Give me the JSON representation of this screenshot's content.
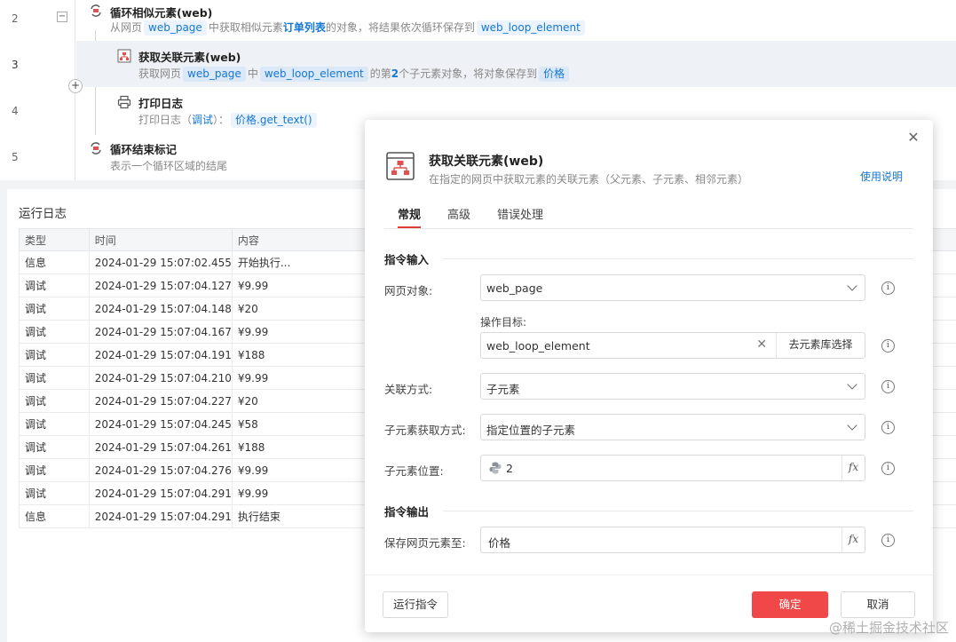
{
  "flow": {
    "steps": [
      {
        "num": "2",
        "title": "循环相似元素(web)",
        "desc_parts": [
          "从网页",
          "web_page",
          "中获取相似元素",
          "订单列表",
          "的对象，将结果依次循环保存到",
          "web_loop_element"
        ]
      },
      {
        "num": "3",
        "title": "获取关联元素(web)",
        "desc_parts": [
          "获取网页",
          "web_page",
          "中",
          "web_loop_element",
          "的第",
          "2",
          "个子元素对象，将对象保存到",
          "价格"
        ]
      },
      {
        "num": "4",
        "title": "打印日志",
        "desc_parts": [
          "打印日志（",
          "调试",
          "）：",
          "价格.get_text()"
        ]
      },
      {
        "num": "5",
        "title": "循环结束标记",
        "desc": "表示一个循环区域的结尾"
      }
    ],
    "collapse_symbol": "−",
    "add_symbol": "+"
  },
  "log": {
    "title": "运行日志",
    "columns": [
      "类型",
      "时间",
      "内容"
    ],
    "rows": [
      [
        "信息",
        "2024-01-29 15:07:02.455",
        "开始执行..."
      ],
      [
        "调试",
        "2024-01-29 15:07:04.127",
        "¥9.99"
      ],
      [
        "调试",
        "2024-01-29 15:07:04.148",
        "¥20"
      ],
      [
        "调试",
        "2024-01-29 15:07:04.167",
        "¥9.99"
      ],
      [
        "调试",
        "2024-01-29 15:07:04.191",
        "¥188"
      ],
      [
        "调试",
        "2024-01-29 15:07:04.210",
        "¥9.99"
      ],
      [
        "调试",
        "2024-01-29 15:07:04.227",
        "¥20"
      ],
      [
        "调试",
        "2024-01-29 15:07:04.245",
        "¥58"
      ],
      [
        "调试",
        "2024-01-29 15:07:04.261",
        "¥188"
      ],
      [
        "调试",
        "2024-01-29 15:07:04.276",
        "¥9.99"
      ],
      [
        "调试",
        "2024-01-29 15:07:04.291",
        "¥9.99"
      ],
      [
        "信息",
        "2024-01-29 15:07:04.291",
        "执行结束"
      ]
    ]
  },
  "modal": {
    "close_symbol": "✕",
    "title": "获取关联元素(web)",
    "subtitle": "在指定的网页中获取元素的关联元素（父元素、子元素、相邻元素）",
    "help_link": "使用说明",
    "tabs": [
      "常规",
      "高级",
      "错误处理"
    ],
    "active_tab": "常规",
    "input_section": "指令输入",
    "output_section": "指令输出",
    "fields": {
      "web_page": {
        "label": "网页对象:",
        "value": "web_page"
      },
      "target": {
        "label": "操作目标:",
        "value": "web_loop_element",
        "clear": "✕",
        "pick_label": "去元素库选择"
      },
      "relation": {
        "label": "关联方式:",
        "value": "子元素"
      },
      "child_method": {
        "label": "子元素获取方式:",
        "value": "指定位置的子元素"
      },
      "child_pos": {
        "label": "子元素位置:",
        "value": "2",
        "fx": "fx"
      },
      "save_to": {
        "label": "保存网页元素至:",
        "value": "价格",
        "fx": "fx"
      }
    },
    "info_symbol": "i",
    "buttons": {
      "run": "运行指令",
      "ok": "确定",
      "cancel": "取消"
    }
  },
  "watermark": "@稀土掘金技术社区",
  "colors": {
    "accent": "#1677d2",
    "primary_button": "#f04848",
    "highlight_row": "#eef1f5"
  }
}
